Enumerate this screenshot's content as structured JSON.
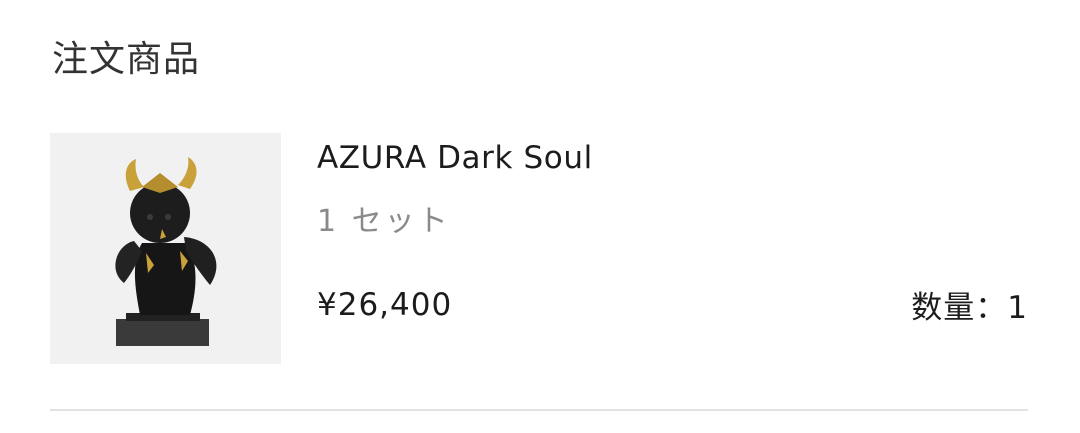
{
  "section": {
    "title": "注文商品"
  },
  "item": {
    "name": "AZURA Dark Soul",
    "variant": "1 セット",
    "price": "¥26,400",
    "quantity_text": "数量：1",
    "image_icon": "figure-product-image"
  },
  "colors": {
    "text_primary": "#1c1c1c",
    "text_secondary": "#8a8a8a",
    "thumbnail_bg": "#f1f1f1",
    "divider": "#e2e2e2",
    "figure_body": "#1b1b1b",
    "figure_gold": "#c9a13b"
  }
}
